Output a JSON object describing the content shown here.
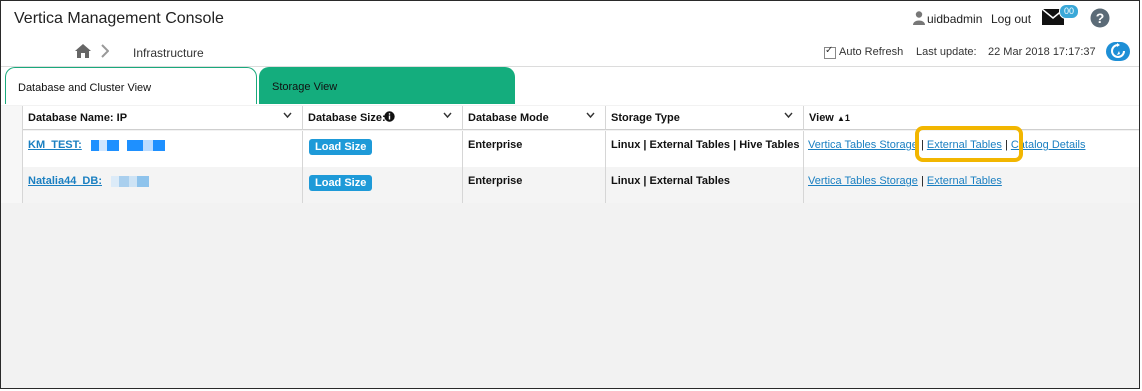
{
  "header": {
    "title": "Vertica Management Console",
    "user": "uidbadmin",
    "logout": "Log out",
    "notifications_count": "00"
  },
  "breadcrumb": {
    "current": "Infrastructure",
    "auto_refresh_label": "Auto Refresh",
    "auto_refresh_checked": true,
    "last_update_label": "Last update:",
    "last_update_value": "22 Mar 2018 17:17:37"
  },
  "tabs": [
    {
      "label": "Database and Cluster View",
      "active": true
    },
    {
      "label": "Storage View",
      "active": false
    }
  ],
  "table": {
    "columns": [
      "Database Name: IP",
      "Database Size:",
      "Database Mode",
      "Storage Type",
      "View"
    ],
    "view_sort_indicator": "1",
    "rows": [
      {
        "name": "KM_TEST:",
        "size_button": "Load Size",
        "mode": "Enterprise",
        "storage": "Linux | External Tables | Hive Tables",
        "views": [
          "Vertica Tables Storage",
          "External Tables",
          "Catalog Details"
        ]
      },
      {
        "name": "Natalia44_DB:",
        "size_button": "Load Size",
        "mode": "Enterprise",
        "storage": "Linux | External Tables",
        "views": [
          "Vertica Tables Storage",
          "External Tables"
        ]
      }
    ]
  },
  "colors": {
    "accent_green": "#14ad7d",
    "link_blue": "#1a7fc1",
    "highlight": "#f2b600"
  }
}
